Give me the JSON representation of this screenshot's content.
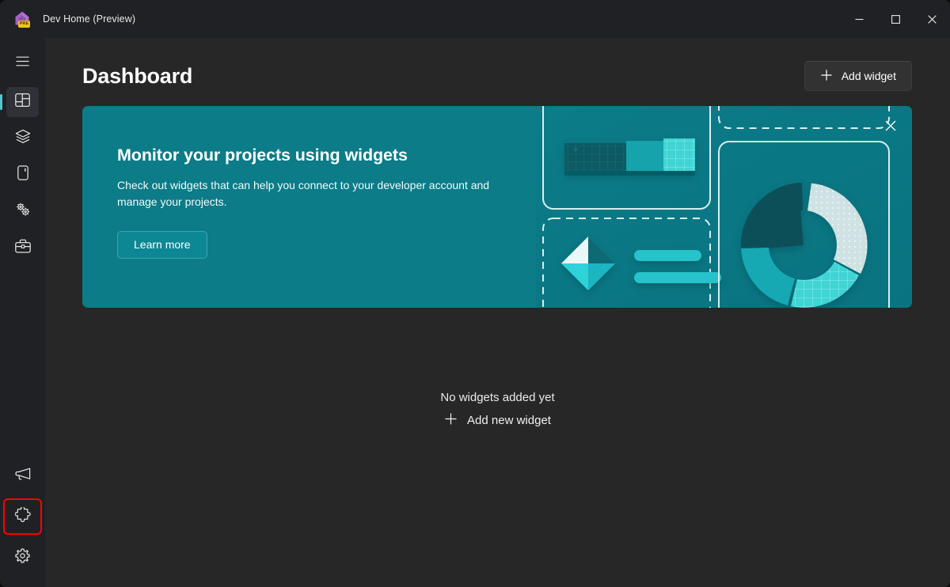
{
  "window": {
    "app_title": "Dev Home (Preview)",
    "app_icon": "dev-home-house-icon",
    "badge_text": "PRE",
    "controls": {
      "minimize": "minimize-icon",
      "maximize": "maximize-icon",
      "close": "close-icon"
    }
  },
  "sidebar": {
    "hamburger": "hamburger-menu-icon",
    "items": [
      {
        "name": "dashboard",
        "icon": "dashboard-layout-icon",
        "active": true
      },
      {
        "name": "machine-configuration",
        "icon": "layers-stack-icon",
        "active": false
      },
      {
        "name": "environments",
        "icon": "device-icon",
        "active": false
      },
      {
        "name": "utilities",
        "icon": "gears-icon",
        "active": false
      },
      {
        "name": "toolbox",
        "icon": "toolbox-icon",
        "active": false
      }
    ],
    "bottom_items": [
      {
        "name": "feedback",
        "icon": "megaphone-icon",
        "highlighted": false
      },
      {
        "name": "extensions",
        "icon": "puzzle-piece-icon",
        "highlighted": true
      },
      {
        "name": "settings",
        "icon": "gear-icon",
        "highlighted": false
      }
    ],
    "highlight_color": "#ff0000",
    "active_indicator_color": "#4fc8cf"
  },
  "header": {
    "title": "Dashboard",
    "add_widget_label": "Add widget",
    "add_widget_icon": "plus-icon"
  },
  "banner": {
    "heading": "Monitor your projects using widgets",
    "body": "Check out widgets that can help you connect to your developer account and manage your projects.",
    "button_label": "Learn more",
    "close_icon": "close-icon",
    "background_color": "#0b7c88",
    "art": {
      "donut_icon": "donut-chart-illustration",
      "bar_icon": "bar-block-illustration",
      "diamond_icon": "diamond-illustration"
    }
  },
  "empty_state": {
    "title": "No widgets added yet",
    "add_label": "Add new widget",
    "add_icon": "plus-icon"
  }
}
